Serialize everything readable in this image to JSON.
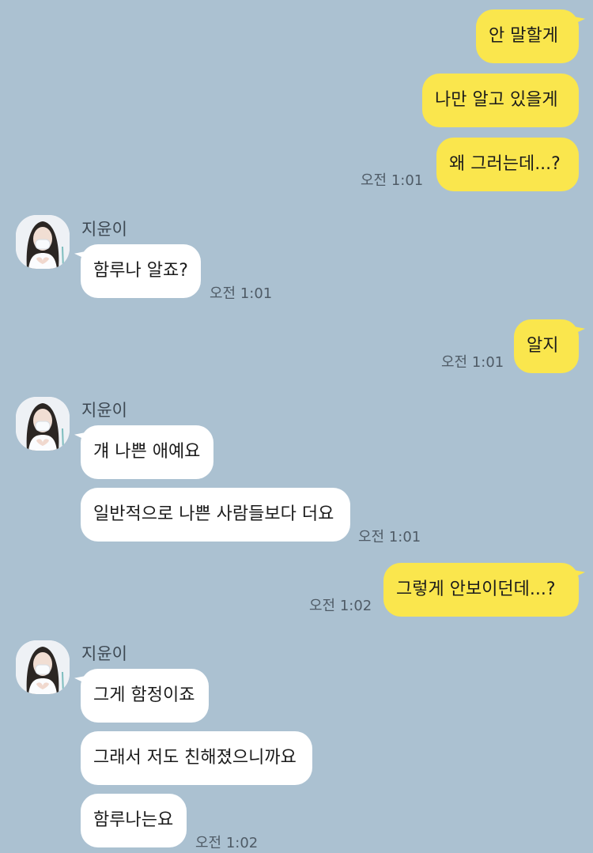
{
  "colors": {
    "background": "#abc1d1",
    "my_bubble": "#fae64d",
    "their_bubble": "#ffffff",
    "timestamp": "#4f5b66"
  },
  "contact": {
    "name": "지윤이",
    "avatar_icon": "profile-photo-icon"
  },
  "messages": {
    "m1": "안 말할게",
    "m2": "나만 알고 있을게",
    "m3": "왜 그러는데...?",
    "m4": "함루나 알죠?",
    "m5": "알지",
    "m6": "걔 나쁜 애예요",
    "m7": "일반적으로 나쁜 사람들보다 더요",
    "m8": "그렇게 안보이던데...?",
    "m9": "그게 함정이죠",
    "m10": "그래서 저도 친해졌으니까요",
    "m11": "함루나는요"
  },
  "times": {
    "t1": "오전 1:01",
    "t2": "오전 1:01",
    "t3": "오전 1:01",
    "t4": "오전 1:01",
    "t5": "오전 1:02",
    "t6": "오전 1:02"
  }
}
